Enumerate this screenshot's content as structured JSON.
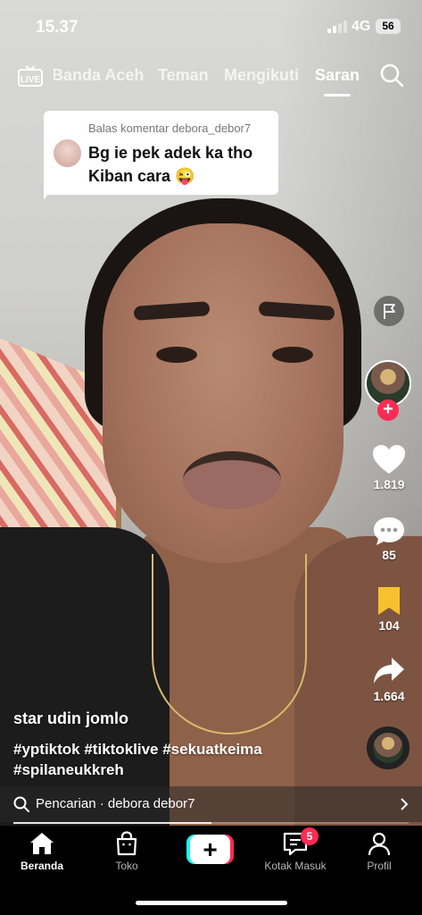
{
  "status_bar": {
    "time": "15.37",
    "network": "4G",
    "battery": "56"
  },
  "top_nav": {
    "live_label": "LIVE",
    "tabs": [
      {
        "label": "Banda Aceh",
        "active": false
      },
      {
        "label": "Teman",
        "active": false
      },
      {
        "label": "Mengikuti",
        "active": false
      },
      {
        "label": "Saran",
        "active": true
      }
    ]
  },
  "reply_card": {
    "header": "Balas komentar debora_debor7",
    "text": "Bg ie pek adek ka tho Kiban cara 😜"
  },
  "right_rail": {
    "likes": "1.819",
    "comments": "85",
    "saves": "104",
    "shares": "1.664",
    "follow_symbol": "+"
  },
  "caption": {
    "username": "star udin jomlo",
    "hashtags": "#yptiktok #tiktoklive #sekuatkeima #spilaneukkreh"
  },
  "search_bar": {
    "text": "Pencarian · debora debor7"
  },
  "video_progress": 0.5,
  "bottom_nav": {
    "items": [
      {
        "label": "Beranda",
        "icon": "home-icon",
        "active": true
      },
      {
        "label": "Toko",
        "icon": "shop-icon",
        "active": false
      },
      {
        "label": "Kotak Masuk",
        "icon": "inbox-icon",
        "active": false,
        "badge": "5"
      },
      {
        "label": "Profil",
        "icon": "profile-icon",
        "active": false
      }
    ],
    "create_symbol": "+"
  },
  "colors": {
    "accent": "#fe2c55",
    "cyan": "#25f4ee",
    "save_yellow": "#f7c12d"
  }
}
